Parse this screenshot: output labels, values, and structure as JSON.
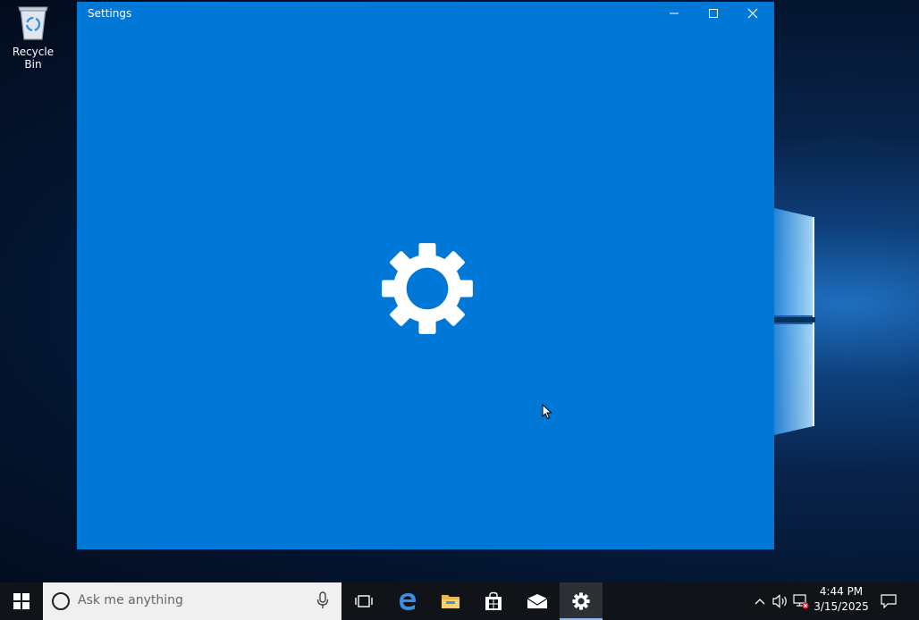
{
  "desktop": {
    "icons": [
      {
        "label": "Recycle Bin",
        "icon": "recycle-bin-icon"
      }
    ]
  },
  "window": {
    "title": "Settings",
    "background": "#0078d7",
    "controls": {
      "minimize": "minimize-icon",
      "maximize": "maximize-icon",
      "close": "close-icon"
    },
    "splash_icon": "gear-icon"
  },
  "taskbar": {
    "search_placeholder": "Ask me anything",
    "apps": [
      {
        "name": "Task View",
        "icon": "task-view-icon",
        "active": false
      },
      {
        "name": "Microsoft Edge",
        "icon": "edge-icon",
        "active": false
      },
      {
        "name": "File Explorer",
        "icon": "folder-icon",
        "active": false
      },
      {
        "name": "Store",
        "icon": "store-icon",
        "active": false
      },
      {
        "name": "Mail",
        "icon": "mail-icon",
        "active": false
      },
      {
        "name": "Settings",
        "icon": "gear-icon",
        "active": true
      }
    ],
    "tray": {
      "time": "4:44 PM",
      "date": "3/15/2025",
      "icons": [
        "chevron-up-icon",
        "volume-icon",
        "network-disconnected-icon",
        "action-center-icon"
      ]
    }
  },
  "colors": {
    "accent": "#0078d7",
    "taskbar": "#101418"
  }
}
